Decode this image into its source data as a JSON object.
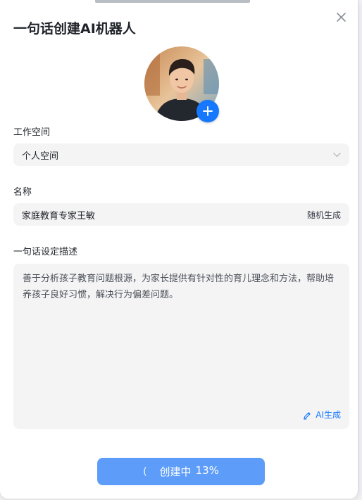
{
  "dialog": {
    "title": "一句话创建AI机器人"
  },
  "workspace": {
    "label": "工作空间",
    "selected": "个人空间"
  },
  "name": {
    "label": "名称",
    "value": "家庭教育专家王敏",
    "random_label": "随机生成"
  },
  "description": {
    "label": "一句话设定描述",
    "value": "善于分析孩子教育问题根源，为家长提供有针对性的育儿理念和方法，帮助培养孩子良好习惯，解决行为偏差问题。",
    "ai_label": "AI生成"
  },
  "create": {
    "spinner": "(",
    "label": "创建中",
    "progress": "13%"
  },
  "colors": {
    "accent": "#1677ff",
    "button": "#5d9cf8",
    "field_bg": "#f4f4f5"
  },
  "icons": [
    "close-icon",
    "plus-icon",
    "chevron-down-icon",
    "edit-icon",
    "loading-spinner-icon"
  ]
}
